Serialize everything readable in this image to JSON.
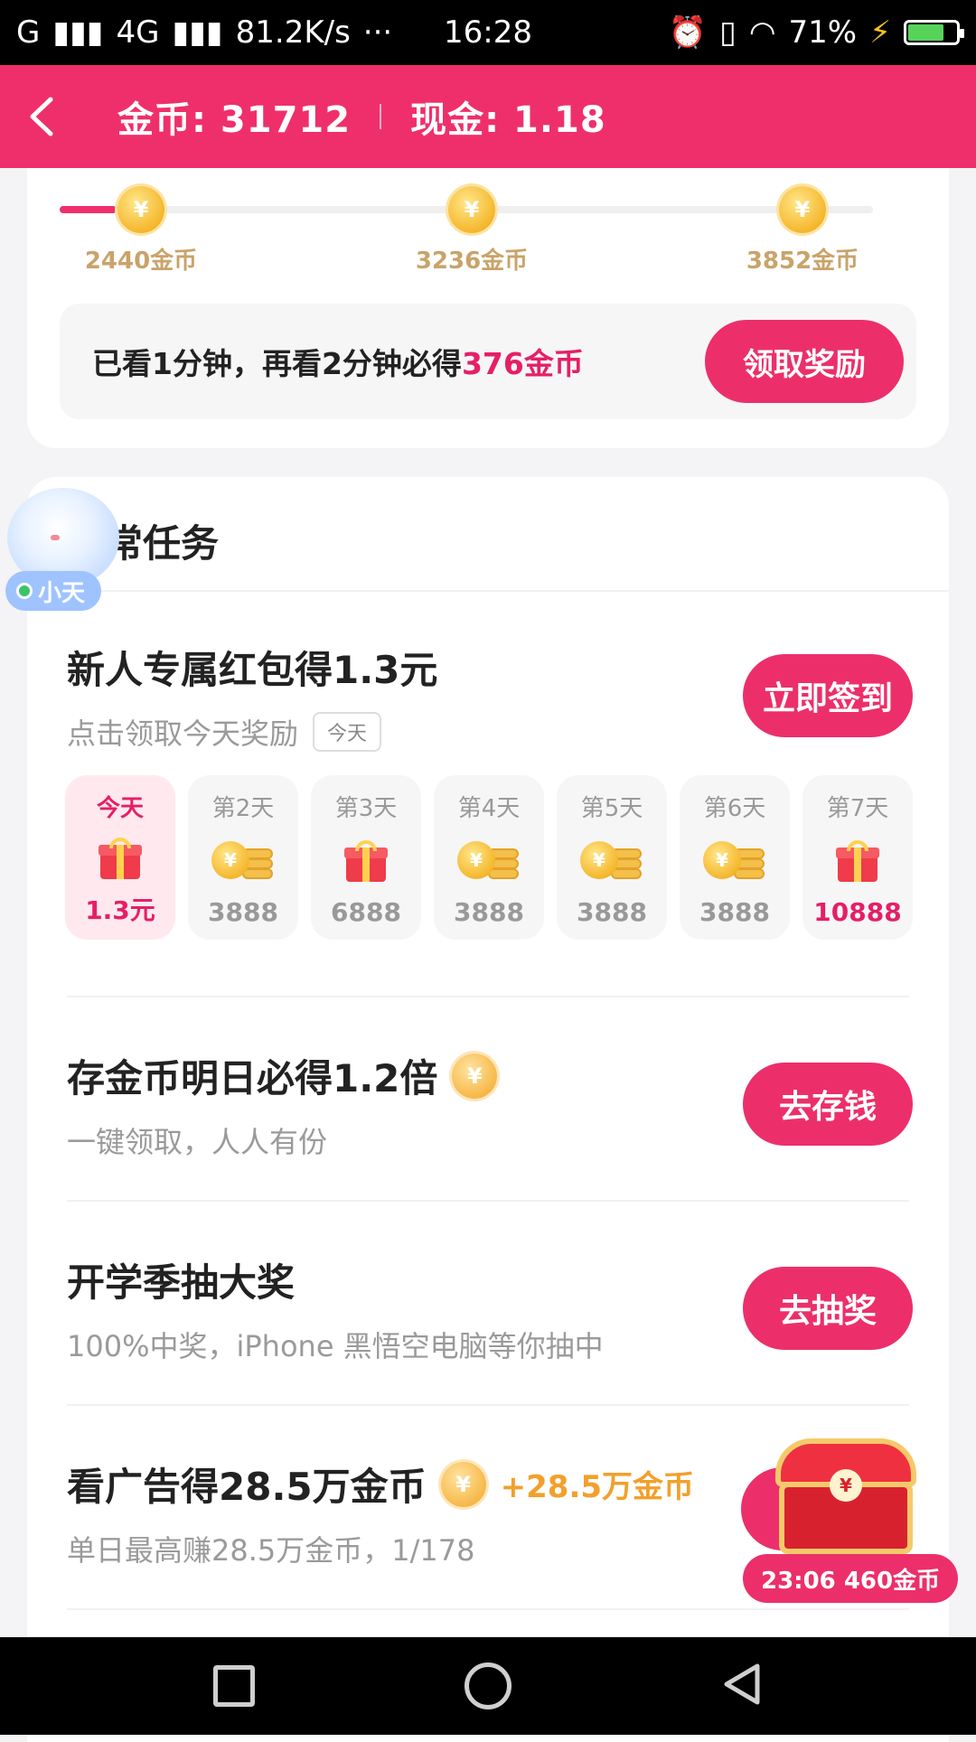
{
  "status_bar": {
    "network": "G",
    "network2": "4G",
    "speed": "81.2K/s",
    "more": "···",
    "time": "16:28",
    "battery": "71%"
  },
  "header": {
    "back_icon": "chevron-left-icon",
    "coins_label": "金币: 31712",
    "cash_label": "现金: 1.18"
  },
  "progress": {
    "completed_fraction": 0.07,
    "milestones": [
      {
        "label": "2440金币"
      },
      {
        "label": "3236金币"
      },
      {
        "label": "3852金币"
      }
    ],
    "info_prefix": "已看1分钟，再看2分钟必得",
    "info_highlight": "376金币",
    "claim_button": "领取奖励"
  },
  "assistant": {
    "name": "小天"
  },
  "daily_tasks": {
    "title": "日常任务",
    "signin": {
      "title": "新人专属红包得1.3元",
      "subtitle": "点击领取今天奖励",
      "tag": "今天",
      "button": "立即签到",
      "days": [
        {
          "label": "今天",
          "value": "1.3元",
          "icon": "gift-icon"
        },
        {
          "label": "第2天",
          "value": "3888",
          "icon": "coins-icon"
        },
        {
          "label": "第3天",
          "value": "6888",
          "icon": "gift-icon"
        },
        {
          "label": "第4天",
          "value": "3888",
          "icon": "coins-icon"
        },
        {
          "label": "第5天",
          "value": "3888",
          "icon": "coins-icon"
        },
        {
          "label": "第6天",
          "value": "3888",
          "icon": "coins-icon"
        },
        {
          "label": "第7天",
          "value": "10888",
          "icon": "gift-icon"
        }
      ]
    },
    "save": {
      "title": "存金币明日必得1.2倍",
      "subtitle": "一键领取，人人有份",
      "button": "去存钱"
    },
    "lottery": {
      "title": "开学季抽大奖",
      "subtitle": "100%中奖，iPhone 黑悟空电脑等你抽中",
      "button": "去抽奖"
    },
    "ads": {
      "title": "看广告得28.5万金币",
      "reward": "+28.5万金币",
      "subtitle": "单日最高赚28.5万金币，1/178"
    }
  },
  "chest": {
    "timer": "23:06 460金币"
  },
  "coin_symbol": "¥",
  "colors": {
    "accent": "#ec2f6a",
    "header": "#ef2f6b",
    "highlight": "#e51f66",
    "coin_gold": "#f5b72d"
  }
}
